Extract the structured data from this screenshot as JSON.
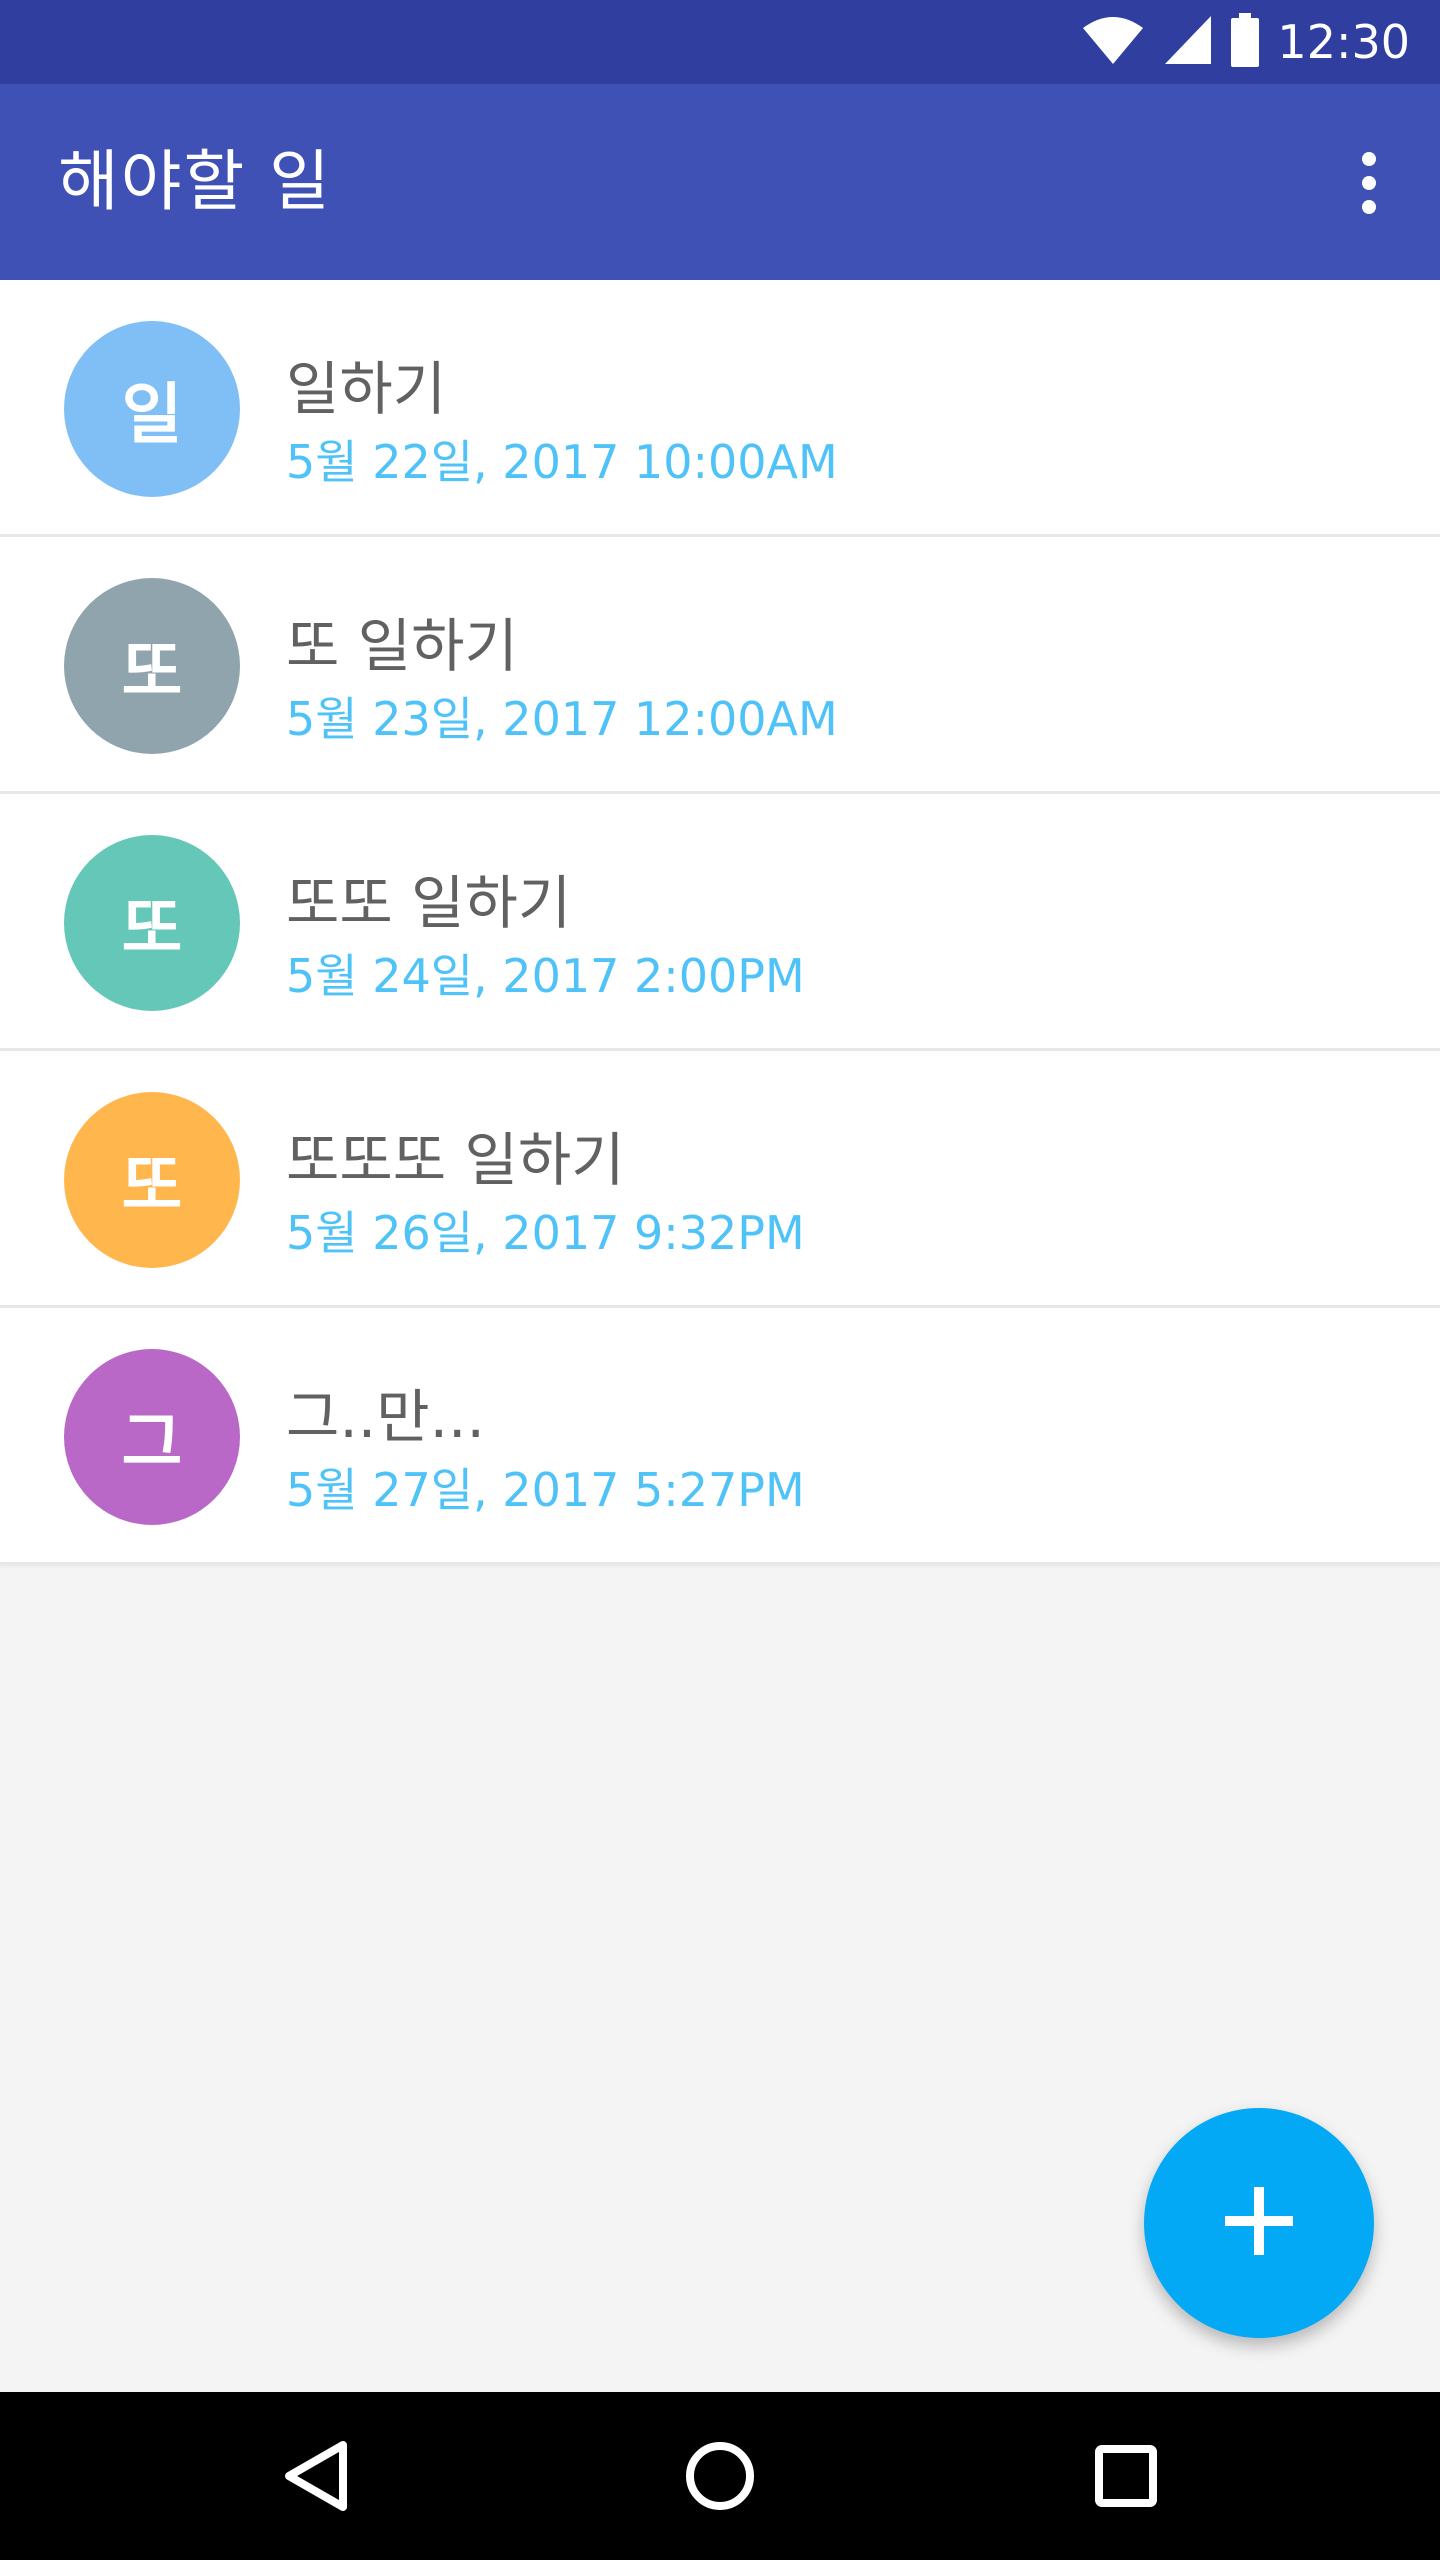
{
  "status_bar": {
    "time": "12:30",
    "icons": [
      "wifi-icon",
      "signal-icon",
      "battery-icon"
    ],
    "color": "#303f9f"
  },
  "app_bar": {
    "title": "해야할 일",
    "menu_icon": "more-vert-icon",
    "color": "#3f51b5"
  },
  "todos": [
    {
      "initial": "일",
      "title": "일하기",
      "date": "5월 22일, 2017  10:00AM",
      "color": "#7fbff5"
    },
    {
      "initial": "또",
      "title": "또 일하기",
      "date": "5월 23일, 2017  12:00AM",
      "color": "#90a4ae"
    },
    {
      "initial": "또",
      "title": "또또 일하기",
      "date": "5월 24일, 2017  2:00PM",
      "color": "#64c7b8"
    },
    {
      "initial": "또",
      "title": "또또또 일하기",
      "date": "5월 26일, 2017  9:32PM",
      "color": "#ffb74d"
    },
    {
      "initial": "그",
      "title": "그..만...",
      "date": "5월 27일, 2017  5:27PM",
      "color": "#ba68c8"
    }
  ],
  "fab": {
    "icon": "add-icon",
    "color": "#03a9f4"
  },
  "nav_bar": {
    "icons": [
      "back-icon",
      "home-icon",
      "recents-icon"
    ]
  }
}
